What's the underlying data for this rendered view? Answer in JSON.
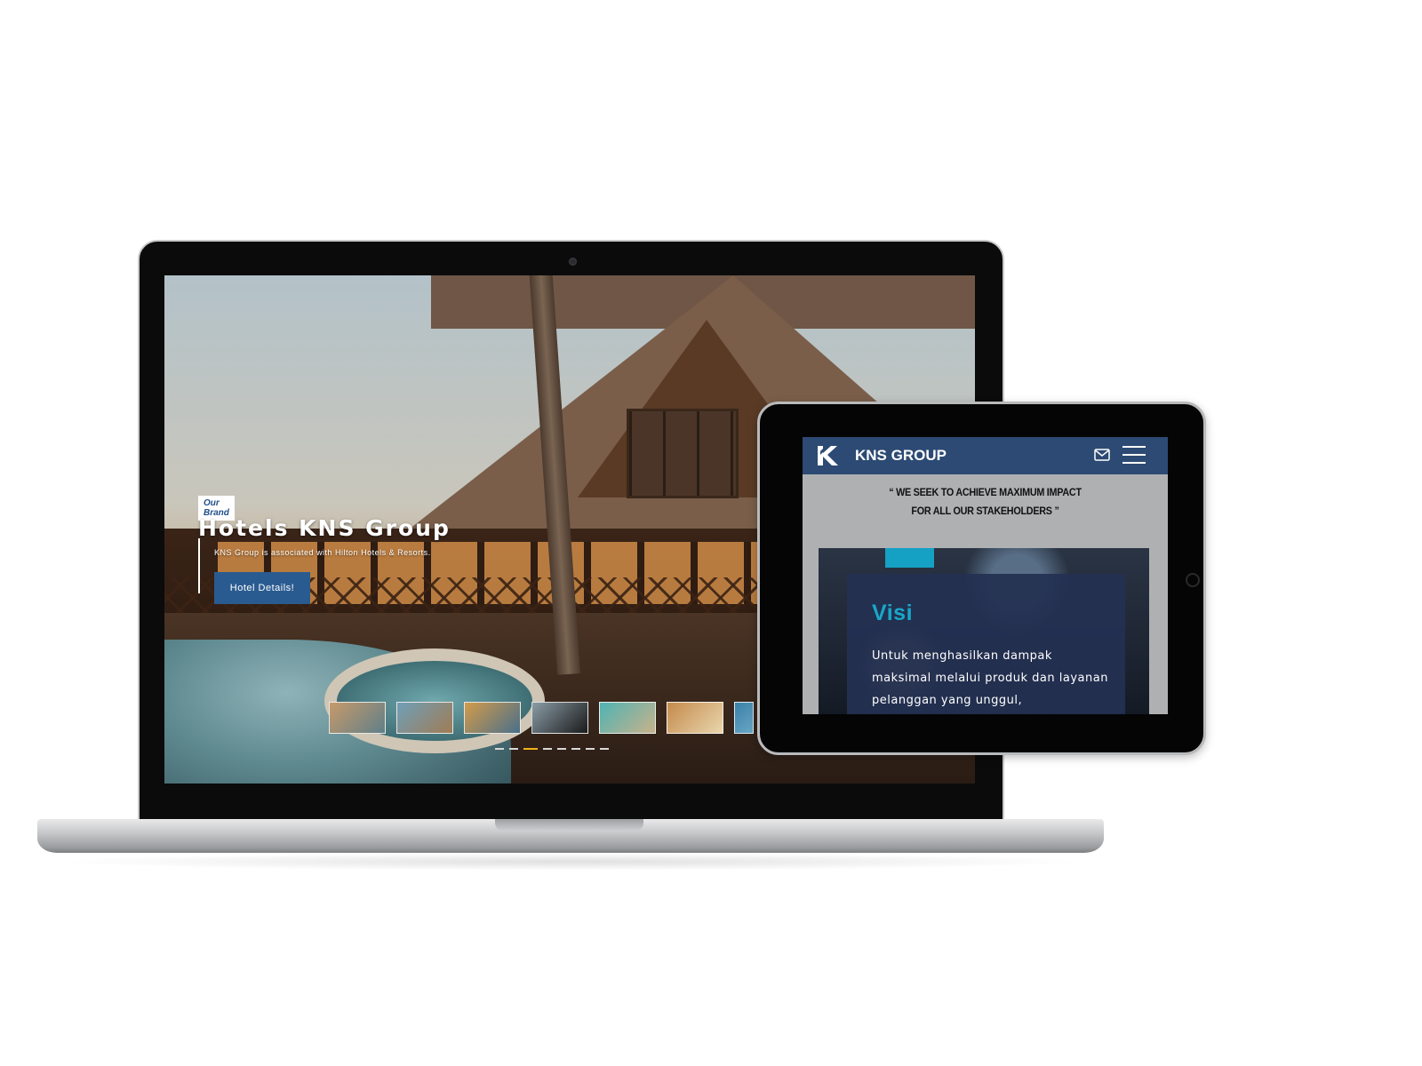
{
  "laptop": {
    "hero": {
      "brand_tag": "Our Brand",
      "title": "Hotels KNS Group",
      "subtitle": "KNS Group is associated with Hilton Hotels & Resorts.",
      "button_label": "Hotel Details!"
    },
    "thumbnails": [
      {
        "name": "hotel-resort",
        "colors": [
          "#c79a6b",
          "#5f7f88"
        ]
      },
      {
        "name": "pool-palms",
        "colors": [
          "#6f9fb8",
          "#a07c55"
        ]
      },
      {
        "name": "coastal-road",
        "colors": [
          "#d39b4a",
          "#496f8a"
        ]
      },
      {
        "name": "black-car",
        "colors": [
          "#8a9ca6",
          "#1a1a1a"
        ]
      },
      {
        "name": "teal-interior",
        "colors": [
          "#4fb3b4",
          "#c8b28a"
        ]
      },
      {
        "name": "warm-hall",
        "colors": [
          "#c48a4c",
          "#e9d6ad"
        ]
      },
      {
        "name": "blue-partial",
        "colors": [
          "#3a7fa8",
          "#6aa7c6"
        ]
      }
    ],
    "slider": {
      "count": 8,
      "active_index": 2
    }
  },
  "tablet": {
    "brand": "KNS GROUP",
    "quote_line1": "“ WE SEEK TO ACHIEVE MAXIMUM IMPACT",
    "quote_line2": "FOR ALL OUR STAKEHOLDERS ”",
    "visi_title": "Visi",
    "visi_text": "Untuk menghasilkan dampak maksimal melalui produk dan layanan pelanggan yang unggul,",
    "colors": {
      "header": "#2c4a73",
      "accent": "#14a1c4"
    }
  }
}
